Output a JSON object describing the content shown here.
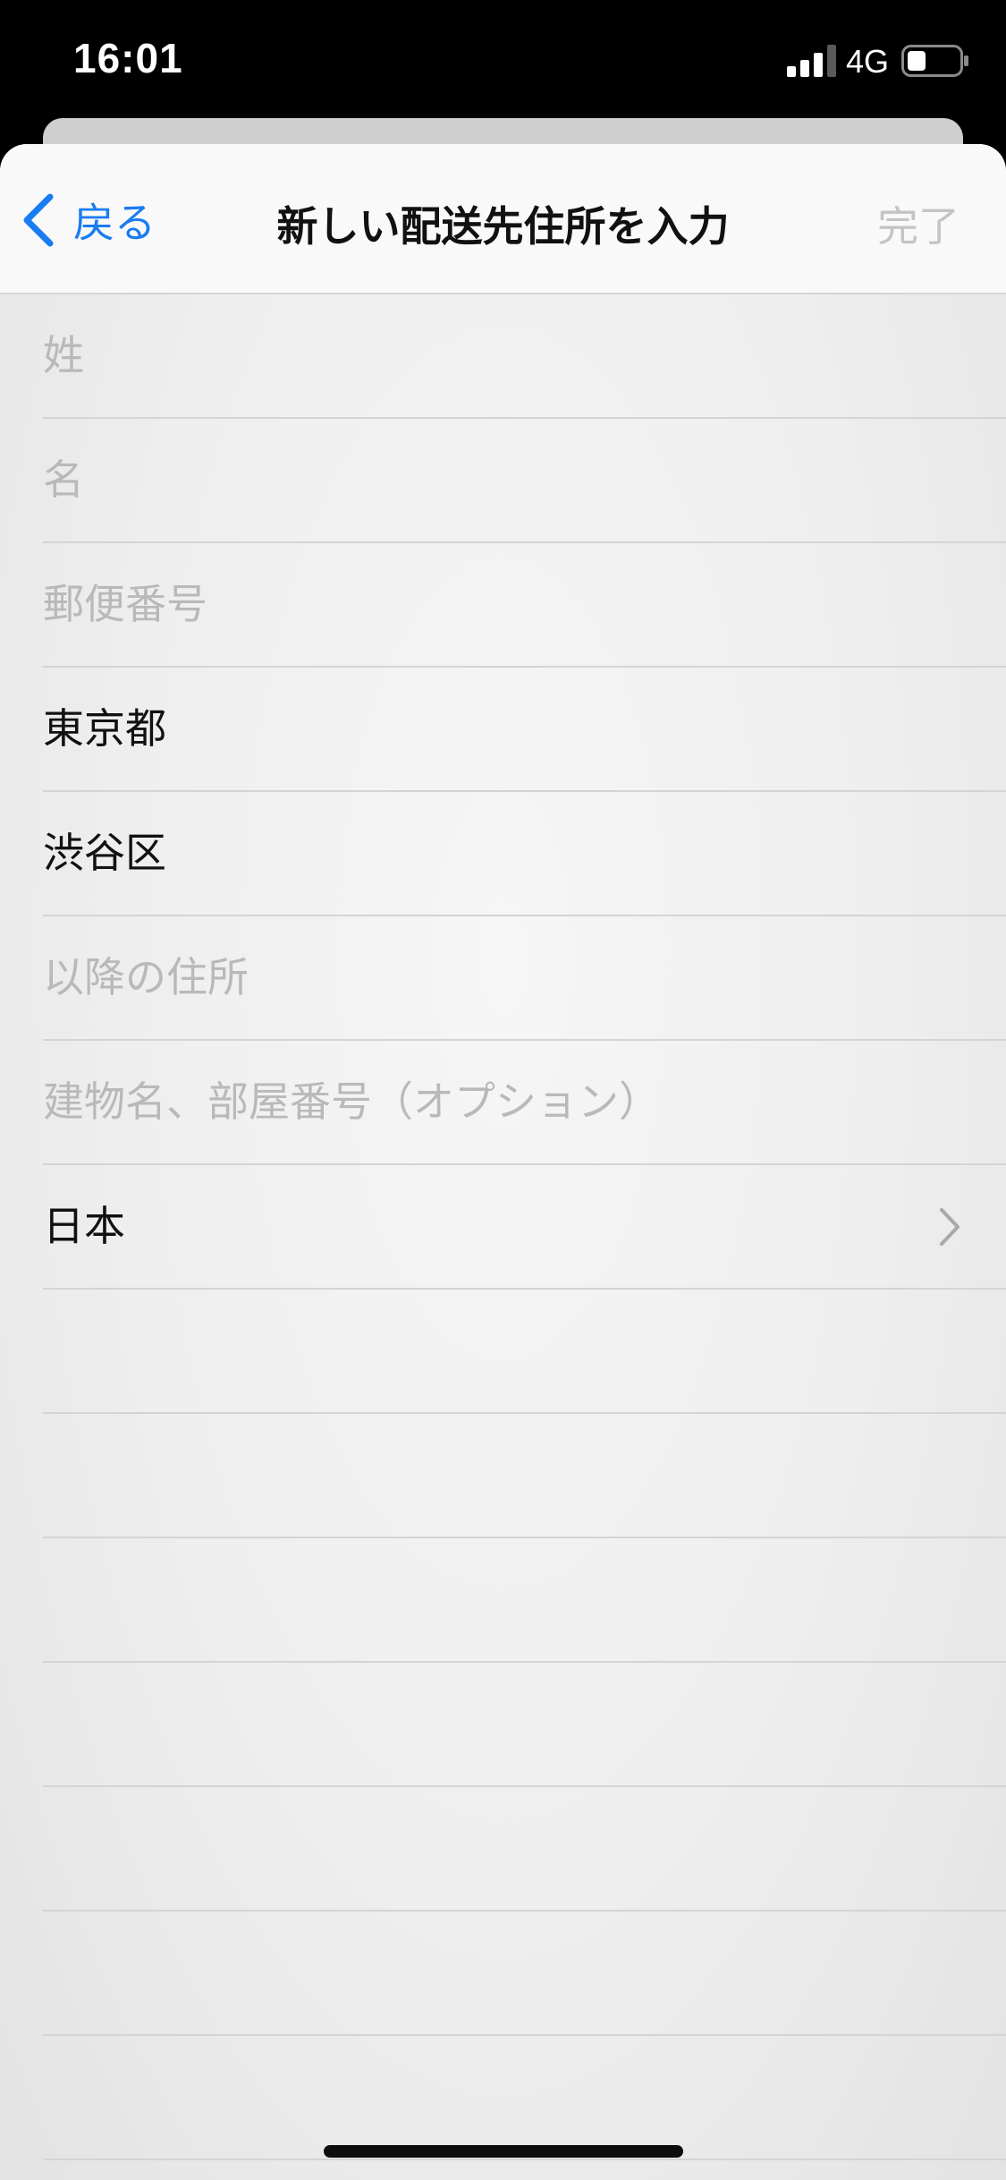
{
  "status_bar": {
    "time": "16:01",
    "network": "4G",
    "signal_icon": "signal-bars-icon",
    "battery_icon": "battery-low-icon"
  },
  "nav": {
    "back_label": "戻る",
    "back_icon": "chevron-left-icon",
    "title": "新しい配送先住所を入力",
    "done_label": "完了"
  },
  "form": {
    "last_name": {
      "placeholder": "姓",
      "value": ""
    },
    "first_name": {
      "placeholder": "名",
      "value": ""
    },
    "postal_code": {
      "placeholder": "郵便番号",
      "value": ""
    },
    "prefecture": {
      "value": "東京都"
    },
    "city": {
      "value": "渋谷区"
    },
    "address_line": {
      "placeholder": "以降の住所",
      "value": ""
    },
    "building": {
      "placeholder": "建物名、部屋番号（オプション）",
      "value": ""
    },
    "country": {
      "value": "日本",
      "icon": "chevron-right-icon"
    }
  },
  "colors": {
    "accent": "#1a7cf2",
    "placeholder": "#b9b9b9",
    "disabled": "#c4c4c4",
    "text": "#111111"
  }
}
